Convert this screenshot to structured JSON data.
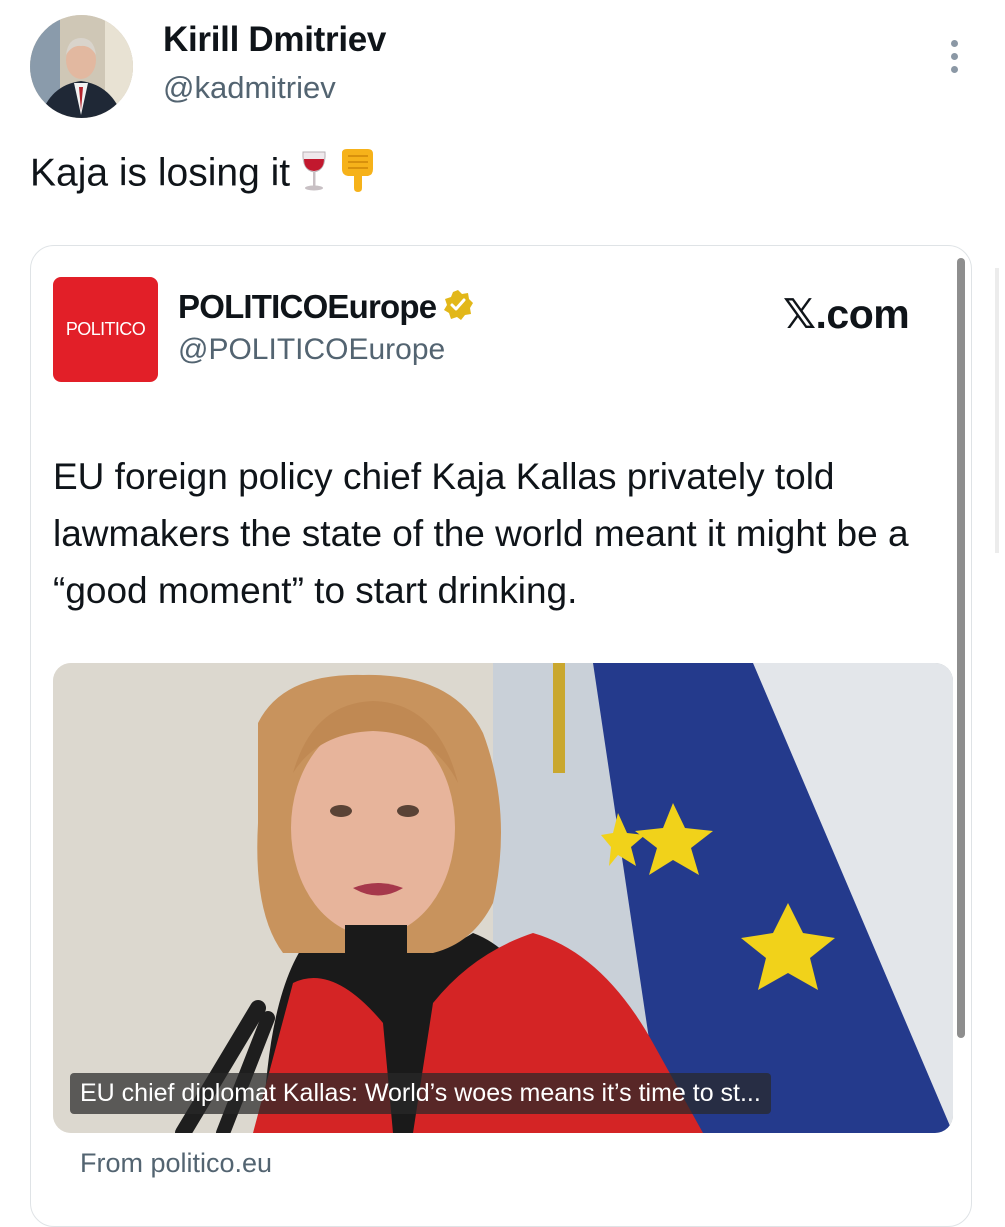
{
  "author": {
    "display_name": "Kirill Dmitriev",
    "handle": "@kadmitriev",
    "avatar_icon": "profile-photo"
  },
  "tweet": {
    "text": "Kaja is losing it",
    "emojis": [
      "wine-glass-icon",
      "pointing-down-icon"
    ]
  },
  "quoted": {
    "logo_text": "POLITICO",
    "name": "POLITICOEurope",
    "verified": true,
    "handle": "@POLITICOEurope",
    "site_label": "𝕏.com",
    "text": "EU foreign policy chief Kaja Kallas privately told lawmakers the state of the world meant it might be a “good moment” to start drinking.",
    "image_caption": "EU chief diplomat Kallas: World’s woes means it’s time to st...",
    "source": "From politico.eu"
  },
  "colors": {
    "politico_red": "#e21f28",
    "verified_gold": "#e2b719",
    "secondary_text": "#536471"
  }
}
